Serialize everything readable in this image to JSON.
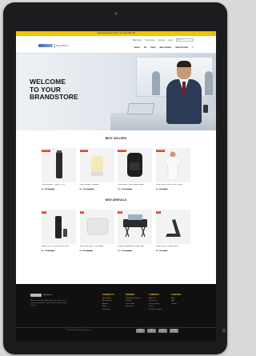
{
  "promo": {
    "text": "Celebrate Festive Offer: Get Flat 10% Off",
    "close": "x"
  },
  "header": {
    "logo_text": "BrandStore",
    "top_links": [
      "Bulk Order",
      "Track Order",
      "Contact",
      "Login"
    ],
    "search_placeholder": "Search",
    "nav": [
      "Home",
      "All",
      "Shop",
      "Best Sellers",
      "New Arrivals"
    ]
  },
  "hero": {
    "line1": "WELCOME",
    "line2": "TO YOUR",
    "line3": "BRANDSTORE"
  },
  "best_sellers": {
    "title": "BEST SELLERS",
    "items": [
      {
        "badge": "Best Seller",
        "name": "Thermo Bottle - 750ml | 2 Pcs",
        "price": "Rs. 899",
        "mrp": "Rs. 1,199"
      },
      {
        "badge": "Best Seller",
        "name": "Touch Lamp BT Speaker",
        "price": "Rs. 1,499",
        "mrp": "Rs. 1,999"
      },
      {
        "badge": "Best Seller",
        "name": "Classic Anti - Theft Laptop Backp",
        "price": "Rs. 1,699",
        "mrp": "Rs. 2,299"
      },
      {
        "badge": "Best Seller",
        "name": "Cotton Dry Fit Polo T-Shirt - White",
        "price": "Rs. 599",
        "mrp": "Rs. 799"
      }
    ]
  },
  "new_arrivals": {
    "title": "NEW ARRIVALS",
    "items": [
      {
        "badge": "New",
        "name": "Explore Duo - Smart Vacuum Flask",
        "price": "Rs. 799",
        "mrp": "Rs. 1,099"
      },
      {
        "badge": "New",
        "name": "Slim Power Bank - 10000mAh",
        "price": "Rs. 999",
        "mrp": "Rs. 1,399"
      },
      {
        "badge": "New",
        "name": "Foldable Ergonomic Laptop Table",
        "price": "Rs. 1,299",
        "mrp": "Rs. 1,799"
      },
      {
        "badge": "New",
        "name": "Mobile Stand - Mobile Stand",
        "price": "Rs. 299",
        "mrp": "Rs. 449"
      }
    ]
  },
  "footer": {
    "logo_text": "BrandStore",
    "about": "Welcome to your BrandStore. A one-stop shop for all your corporate merchandise needs. Explore a curated range of products.",
    "columns": [
      {
        "title": "PRODUCTS",
        "links": [
          "Best Sellers",
          "New Arrivals",
          "Apparel",
          "Bags",
          "Drinkware"
        ]
      },
      {
        "title": "ORDERS",
        "links": [
          "Shipping & Delivery",
          "Returns",
          "Track Order",
          "Bulk Order"
        ]
      },
      {
        "title": "COMPANY",
        "links": [
          "About Us",
          "Contact Us",
          "Privacy Policy",
          "Terms",
          "Customer Support"
        ]
      },
      {
        "title": "SUPPORT",
        "links": [
          "FAQ",
          "Help",
          "Contact"
        ]
      }
    ],
    "copyright": "© 2024 BrandStore. All Rights Reserved.",
    "payments": [
      "VISA",
      "MC",
      "UPI",
      "RuPay"
    ]
  }
}
